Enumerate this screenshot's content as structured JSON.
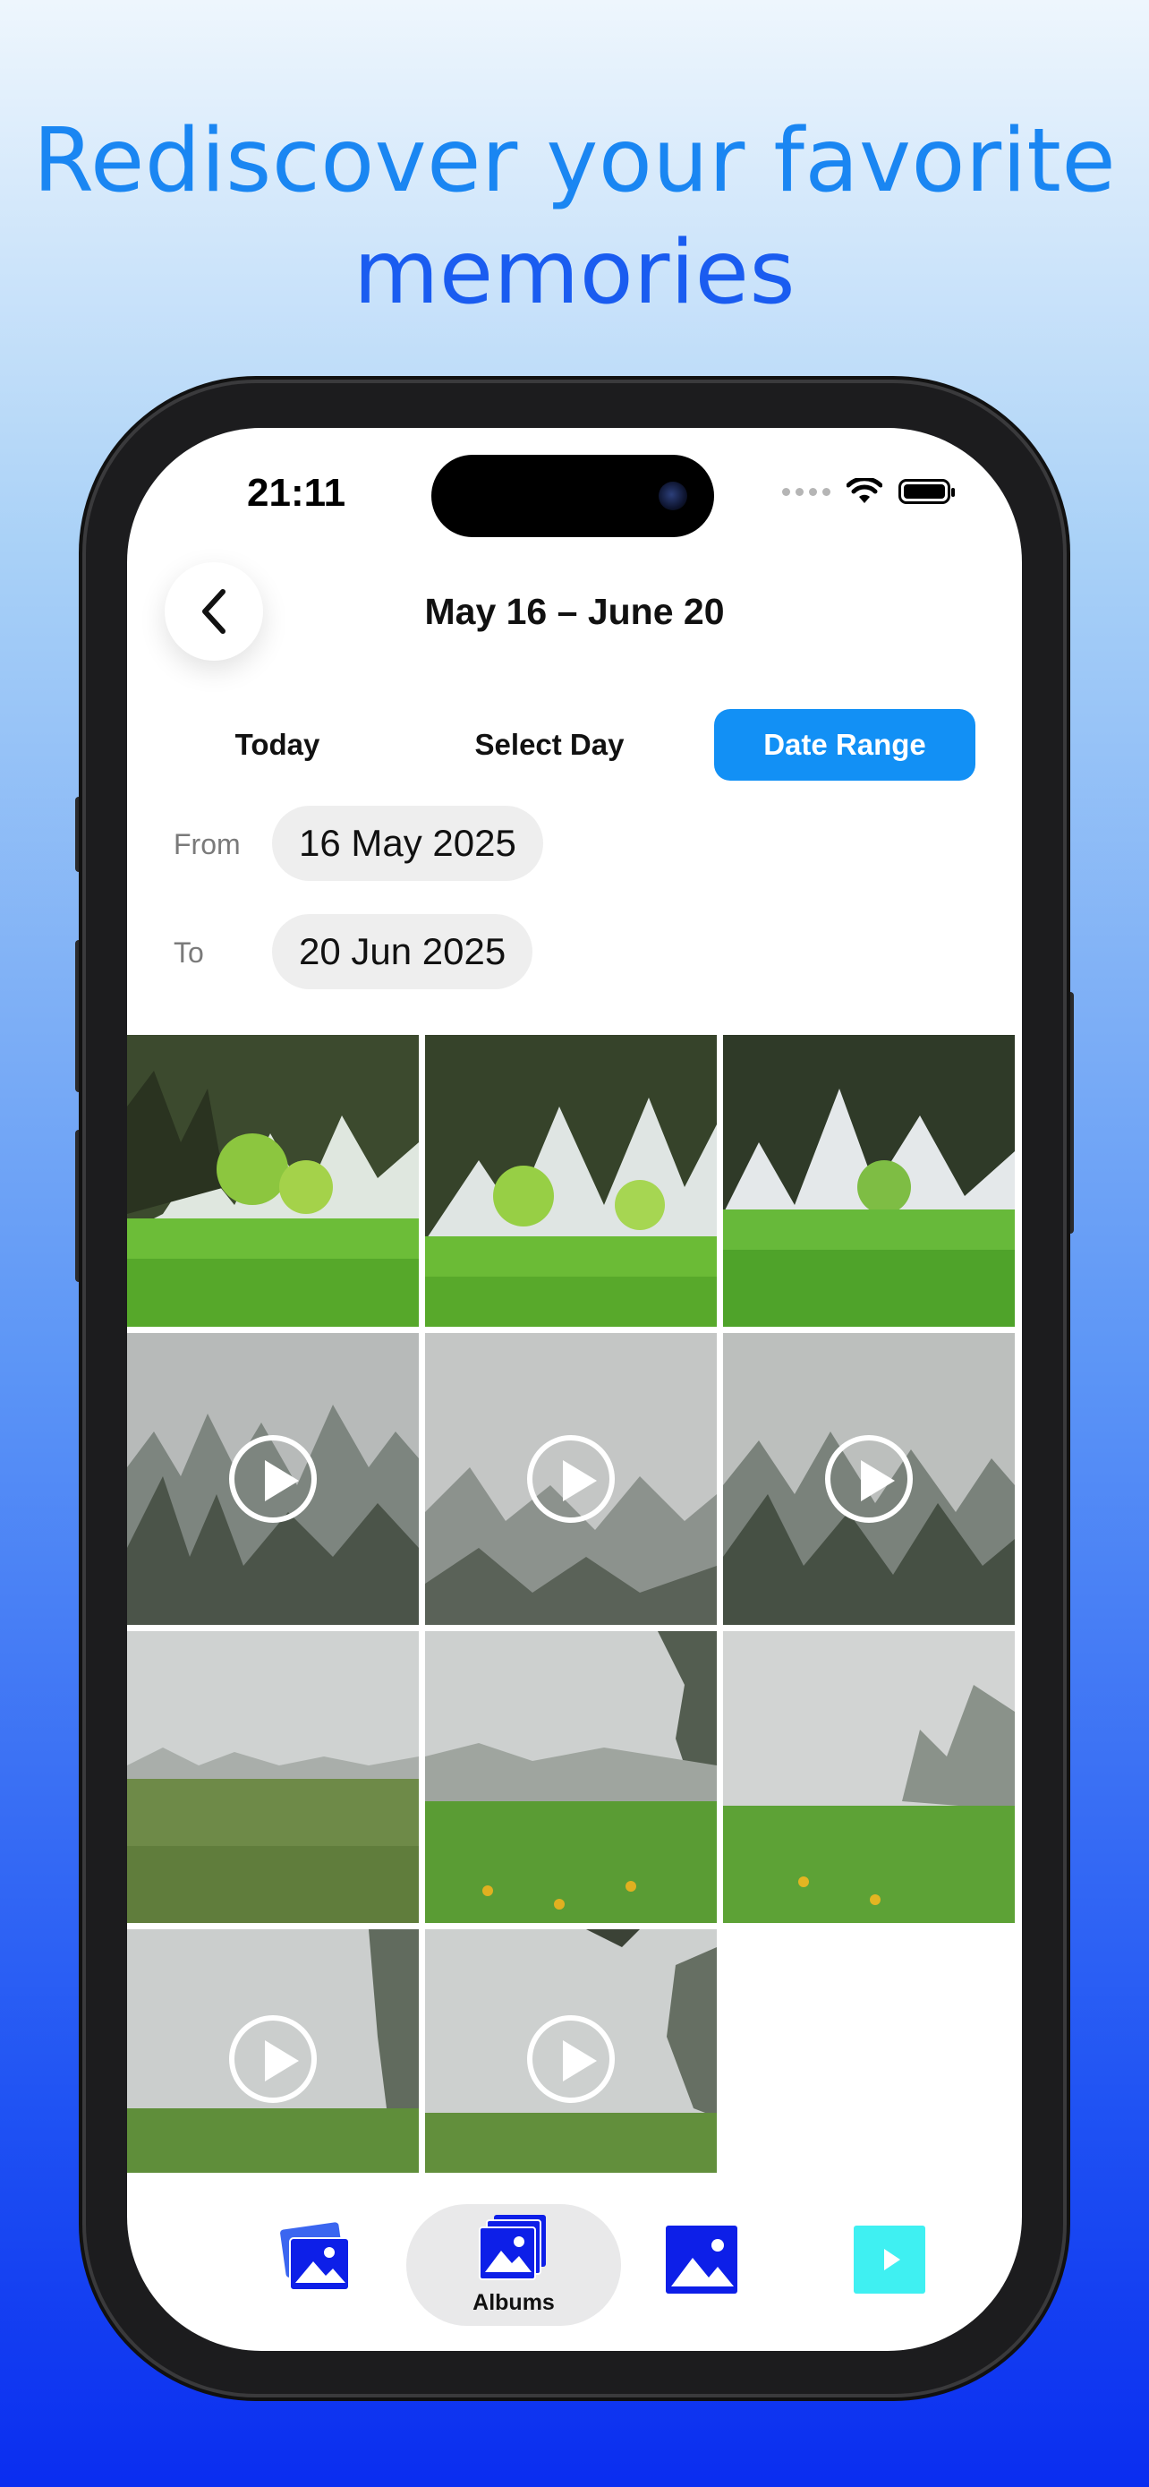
{
  "headline": {
    "line1": "Rediscover your favorite",
    "line2": "memories"
  },
  "status_bar": {
    "time": "21:11"
  },
  "nav": {
    "title": "May 16 – June 20"
  },
  "segments": [
    {
      "label": "Today",
      "active": false
    },
    {
      "label": "Select Day",
      "active": false
    },
    {
      "label": "Date Range",
      "active": true
    }
  ],
  "date_range": {
    "from_label": "From",
    "from_value": "16 May 2025",
    "to_label": "To",
    "to_value": "20 Jun 2025"
  },
  "photos": [
    {
      "kind": "photo",
      "scene": "forest-meadow"
    },
    {
      "kind": "photo",
      "scene": "forest-meadow"
    },
    {
      "kind": "photo",
      "scene": "forest-meadow"
    },
    {
      "kind": "video",
      "scene": "foggy-forest"
    },
    {
      "kind": "video",
      "scene": "foggy-forest"
    },
    {
      "kind": "video",
      "scene": "foggy-forest"
    },
    {
      "kind": "photo",
      "scene": "foggy-meadow"
    },
    {
      "kind": "photo",
      "scene": "foggy-meadow"
    },
    {
      "kind": "photo",
      "scene": "foggy-meadow"
    },
    {
      "kind": "video",
      "scene": "foggy-meadow"
    },
    {
      "kind": "video",
      "scene": "foggy-meadow"
    }
  ],
  "tabbar": {
    "items": [
      {
        "icon": "photos-stack-icon",
        "label": ""
      },
      {
        "icon": "albums-icon",
        "label": "Albums",
        "active": true
      },
      {
        "icon": "photo-icon",
        "label": ""
      },
      {
        "icon": "video-play-icon",
        "label": ""
      }
    ]
  },
  "colors": {
    "accent": "#1290f5",
    "tab_icon": "#0d1fe8",
    "video_tab": "#3ff0f2"
  }
}
